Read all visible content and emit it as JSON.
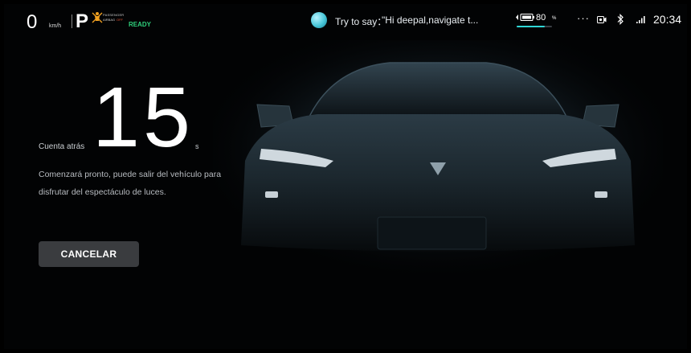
{
  "status_bar": {
    "speed": "0",
    "speed_unit": "km/h",
    "gear": "P",
    "airbag_line1": "PASSENGER",
    "airbag_line2": "AIRBAG",
    "airbag_state": "OFF",
    "ready": "READY",
    "voice_prefix": "Try to say：",
    "voice_hint": "\"Hi deepal,navigate t...",
    "battery_percent": "80",
    "battery_unit": "%",
    "battery_level": 0.8,
    "more": "···",
    "time": "20:34"
  },
  "countdown": {
    "label": "Cuenta atrás",
    "value": "15",
    "unit": "s",
    "message": "Comenzará pronto, puede salir del vehículo para disfrutar del espectáculo de luces."
  },
  "actions": {
    "cancel_label": "CANCELAR"
  },
  "colors": {
    "ready_green": "#2fd07b",
    "airbag_off_red": "#e25533",
    "battery_teal": "#2fd6d6",
    "button_bg": "#3a3c3f"
  }
}
